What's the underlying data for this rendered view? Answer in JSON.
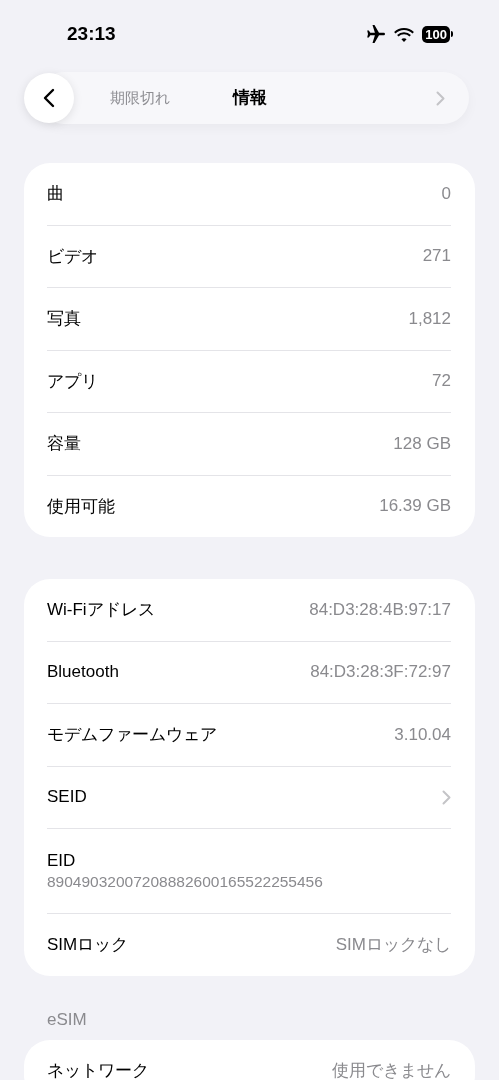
{
  "status_bar": {
    "time": "23:13",
    "battery": "100"
  },
  "nav": {
    "title": "情報",
    "scrolled_under": "期限切れ"
  },
  "groups": [
    {
      "rows": [
        {
          "kind": "value",
          "label": "曲",
          "value": "0"
        },
        {
          "kind": "value",
          "label": "ビデオ",
          "value": "271"
        },
        {
          "kind": "value",
          "label": "写真",
          "value": "1,812"
        },
        {
          "kind": "value",
          "label": "アプリ",
          "value": "72"
        },
        {
          "kind": "value",
          "label": "容量",
          "value": "128 GB"
        },
        {
          "kind": "value",
          "label": "使用可能",
          "value": "16.39 GB"
        }
      ]
    },
    {
      "rows": [
        {
          "kind": "value",
          "label": "Wi-Fiアドレス",
          "value": "84:D3:28:4B:97:17"
        },
        {
          "kind": "value",
          "label": "Bluetooth",
          "value": "84:D3:28:3F:72:97"
        },
        {
          "kind": "value",
          "label": "モデムファームウェア",
          "value": "3.10.04"
        },
        {
          "kind": "chevron",
          "label": "SEID"
        },
        {
          "kind": "stacked",
          "label": "EID",
          "value": "89049032007208882600165522255456"
        },
        {
          "kind": "value",
          "label": "SIMロック",
          "value": "SIMロックなし"
        }
      ]
    },
    {
      "header": "eSIM",
      "rows": [
        {
          "kind": "value",
          "label": "ネットワーク",
          "value": "使用できません"
        }
      ]
    }
  ]
}
